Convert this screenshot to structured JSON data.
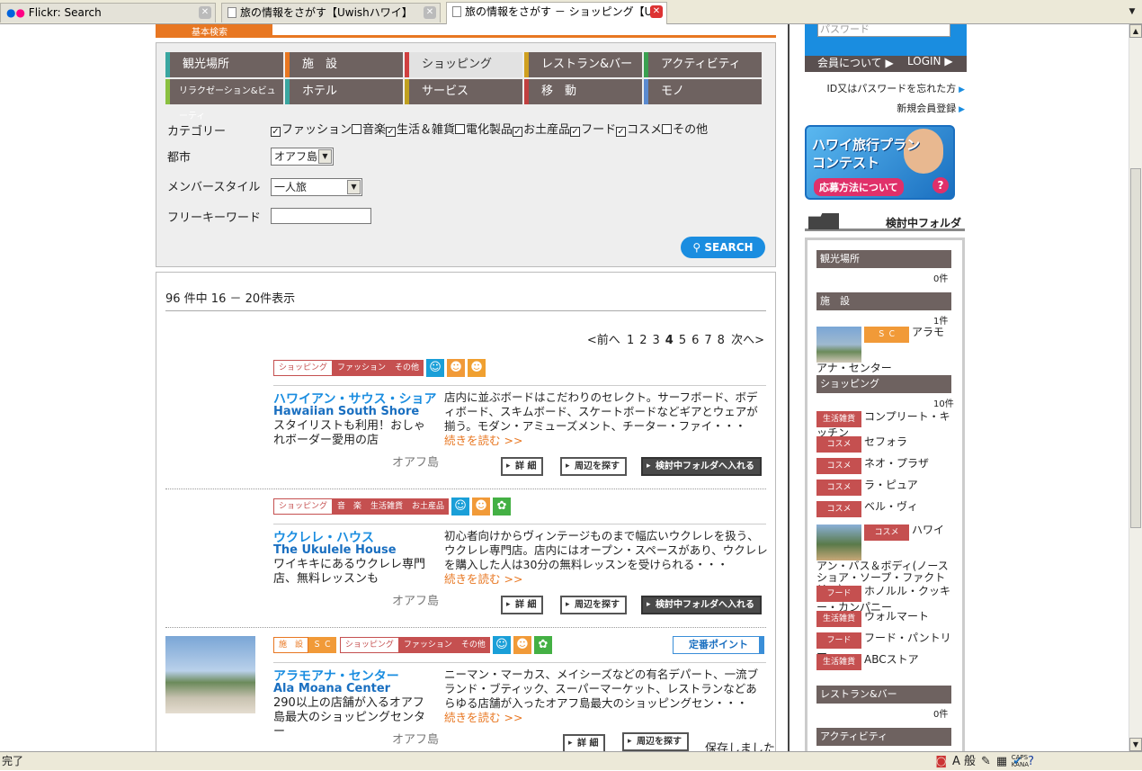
{
  "browser": {
    "tabs": [
      {
        "label": "Flickr: Search"
      },
      {
        "label": "旅の情報をさがす【Uwishハワイ】"
      },
      {
        "label": "旅の情報をさがす － ショッピング【U..."
      }
    ],
    "status": "完了",
    "caps": "CAPS",
    "kana": "KANA",
    "ime_mode": "A 般"
  },
  "search": {
    "header_tab": "基本検索",
    "nav": [
      {
        "label": "観光場所",
        "color": "#3aa6a0"
      },
      {
        "label": "施　設",
        "color": "#e87722"
      },
      {
        "label": "ショッピング",
        "color": "#d04040"
      },
      {
        "label": "レストラン&バー",
        "color": "#d0a020"
      },
      {
        "label": "アクティビティ",
        "color": "#3aa050"
      },
      {
        "label": "リラクゼーション&ビューティ",
        "color": "#8ac040"
      },
      {
        "label": "ホテル",
        "color": "#3aa6a0"
      },
      {
        "label": "サービス",
        "color": "#c0a020"
      },
      {
        "label": "移　動",
        "color": "#c04040"
      },
      {
        "label": "モノ",
        "color": "#5a8ad0"
      }
    ],
    "category_label": "カテゴリー",
    "categories": [
      {
        "label": "ファッション",
        "checked": true
      },
      {
        "label": "音楽",
        "checked": false
      },
      {
        "label": "生活＆雑貨",
        "checked": true
      },
      {
        "label": "電化製品",
        "checked": false
      },
      {
        "label": "お土産品",
        "checked": true
      },
      {
        "label": "フード",
        "checked": true
      },
      {
        "label": "コスメ",
        "checked": true
      },
      {
        "label": "その他",
        "checked": false
      }
    ],
    "city_label": "都市",
    "city_value": "オアフ島",
    "member_label": "メンバースタイル",
    "member_value": "一人旅",
    "keyword_label": "フリーキーワード",
    "keyword_value": "",
    "search_button": "SEARCH"
  },
  "results": {
    "count_text": "96 件中 16 － 20件表示",
    "pager": {
      "prev": "<前へ",
      "pages": [
        "1",
        "2",
        "3",
        "4",
        "5",
        "6",
        "7",
        "8"
      ],
      "current": "4",
      "next": "次へ>"
    },
    "items": [
      {
        "tags": [
          "ショッピング",
          "ファッション",
          "その他"
        ],
        "title": "ハワイアン・サウス・ショア",
        "title_en": "Hawaiian South Shore",
        "sub": "スタイリストも利用！おしゃれボーダー愛用の店",
        "desc": "店内に並ぶボードはこだわりのセレクト。サーフボード、ボディボード、スキムボード、スケートボードなどギアとウェアが揃う。モダン・アミューズメント、チーター・ファイ・・・",
        "more": "続きを読む >>",
        "area": "オアフ島",
        "buttons": [
          "詳 細",
          "周辺を探す",
          "検討中フォルダへ入れる"
        ]
      },
      {
        "tags": [
          "ショッピング",
          "音　楽",
          "生活雑貨",
          "お土産品"
        ],
        "title": "ウクレレ・ハウス",
        "title_en": "The Ukulele House",
        "sub": "ワイキキにあるウクレレ専門店、無料レッスンも",
        "desc": "初心者向けからヴィンテージものまで幅広いウクレレを扱う、ウクレレ専門店。店内にはオープン・スペースがあり、ウクレレを購入した人は30分の無料レッスンを受けられる・・・",
        "more": "続きを読む >>",
        "area": "オアフ島",
        "buttons": [
          "詳 細",
          "周辺を探す",
          "検討中フォルダへ入れる"
        ]
      },
      {
        "tags_a": [
          "施　設",
          "Ｓ Ｃ"
        ],
        "tags": [
          "ショッピング",
          "ファッション",
          "その他"
        ],
        "point": "定番ポイント",
        "title": "アラモアナ・センター",
        "title_en": "Ala Moana Center",
        "sub": "290以上の店舗が入るオアフ島最大のショッピングセンター",
        "desc": "ニーマン・マーカス、メイシーズなどの有名デパート、一流ブランド・ブティック、スーパーマーケット、レストランなどあらゆる店舗が入ったオアフ島最大のショッピングセン・・・",
        "more": "続きを読む >>",
        "area": "オアフ島",
        "buttons": [
          "詳 細",
          "周辺を探す"
        ],
        "saved": "保存しました"
      }
    ]
  },
  "sidebar": {
    "password_placeholder": "パスワード",
    "member_link": "会員について ▶",
    "login_link": "LOGIN ▶",
    "forgot": "ID又はパスワードを忘れた方",
    "register": "新規会員登録",
    "banner_title": "ハワイ旅行プランコンテスト",
    "banner_sub": "応募方法について",
    "banner_q": "?",
    "folder_title": "検討中フォルダ",
    "folders": {
      "sightseeing": {
        "label": "観光場所",
        "count": "0件"
      },
      "facility": {
        "label": "施　設",
        "count": "1件",
        "items": [
          {
            "tag": "Ｓ Ｃ",
            "name": "アラモアナ・センター"
          }
        ]
      },
      "shopping": {
        "label": "ショッピング",
        "count": "10件",
        "items": [
          {
            "tag": "生活雑貨",
            "name": "コンプリート・キッチン"
          },
          {
            "tag": "コスメ",
            "name": "セフォラ"
          },
          {
            "tag": "コスメ",
            "name": "ネオ・プラザ"
          },
          {
            "tag": "コスメ",
            "name": "ラ・ピュア"
          },
          {
            "tag": "コスメ",
            "name": "ベル・ヴィ"
          },
          {
            "tag": "コスメ",
            "name": "ハワイアン・バス＆ボディ(ノースショア・ソープ・ファクトリー)"
          },
          {
            "tag": "フード",
            "name": "ホノルル・クッキー・カンパニー"
          },
          {
            "tag": "生活雑貨",
            "name": "ウォルマート"
          },
          {
            "tag": "フード",
            "name": "フード・パントリー"
          },
          {
            "tag": "生活雑貨",
            "name": "ABCストア"
          }
        ]
      },
      "restaurant": {
        "label": "レストラン&バー",
        "count": "0件"
      },
      "activity": {
        "label": "アクティビティ"
      }
    }
  }
}
